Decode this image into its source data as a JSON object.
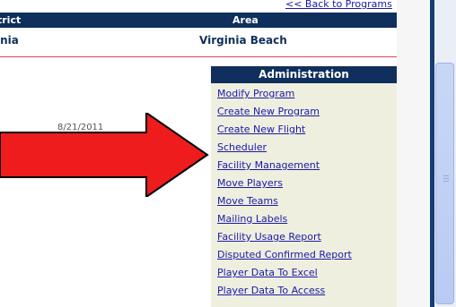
{
  "nav": {
    "back_label": "<< Back to Programs"
  },
  "header": {
    "district": "trict",
    "area": "Area"
  },
  "row": {
    "district": "inia",
    "area": "Virginia Beach"
  },
  "faded_date": "8/21/2011",
  "admin": {
    "title": "Administration",
    "links": [
      "Modify Program",
      "Create New Program",
      "Create New Flight",
      "Scheduler",
      "Facility Management",
      "Move Players",
      "Move Teams",
      "Mailing Labels",
      "Facility Usage Report",
      "Disputed Confirmed Report",
      "Player Data To Excel",
      "Player Data To Access"
    ]
  },
  "colors": {
    "header_bg": "#0f2f5c",
    "link": "#1a1aa6",
    "arrow": "#ee1c1c",
    "panel_bg": "#efefe0"
  }
}
